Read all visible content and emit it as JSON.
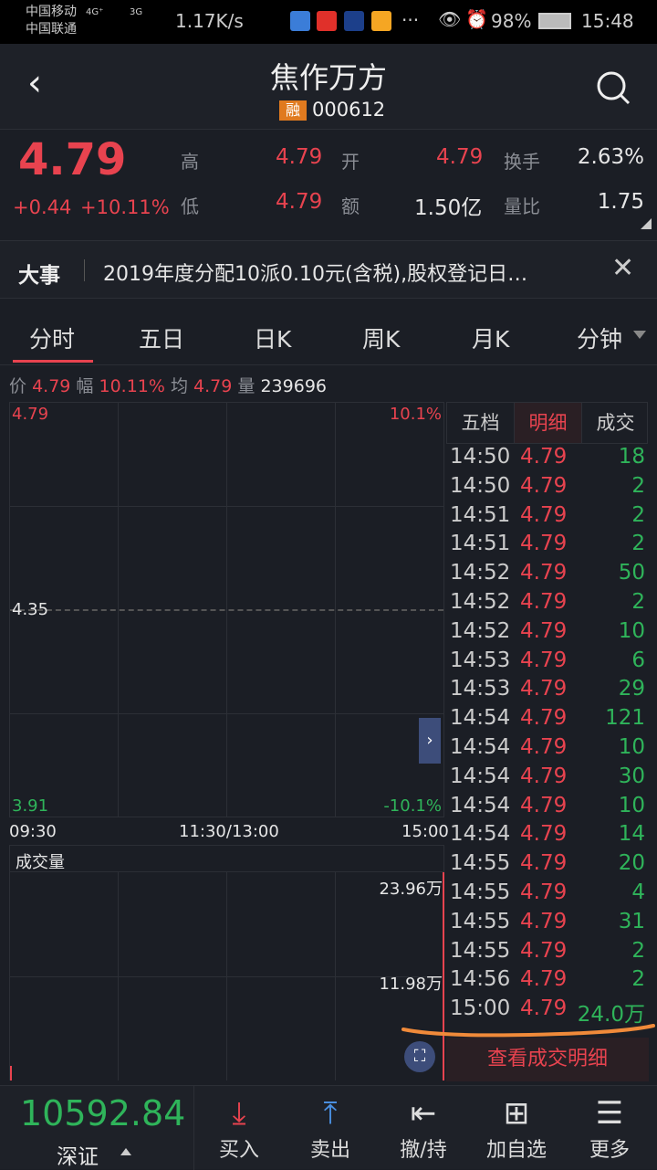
{
  "status": {
    "carrier1": "中国移动",
    "carrier2": "中国联通",
    "net1": "4G⁺",
    "net2": "3G",
    "speed": "1.17K/s",
    "more": "···",
    "battery": "98%",
    "time": "15:48"
  },
  "header": {
    "title": "焦作万方",
    "badge": "融",
    "code": "000612"
  },
  "quote": {
    "price": "4.79",
    "change": "+0.44",
    "pct": "+10.11%",
    "fields": [
      {
        "label": "高",
        "value": "4.79"
      },
      {
        "label": "开",
        "value": "4.79"
      },
      {
        "label": "换手",
        "value": "2.63%"
      },
      {
        "label": "低",
        "value": "4.79"
      },
      {
        "label": "额",
        "value": "1.50亿"
      },
      {
        "label": "量比",
        "value": "1.75"
      }
    ]
  },
  "news": {
    "label": "大事",
    "text": "2019年度分配10派0.10元(含税),股权登记日…"
  },
  "tabs": [
    "分时",
    "五日",
    "日K",
    "周K",
    "月K",
    "分钟"
  ],
  "info": {
    "price_label": "价",
    "price": "4.79",
    "amp_label": "幅",
    "amp": "10.11%",
    "avg_label": "均",
    "avg": "4.79",
    "vol_label": "量",
    "vol": "239696"
  },
  "chart": {
    "top_price": "4.79",
    "top_pct": "10.1%",
    "mid_price": "4.35",
    "bot_price": "3.91",
    "bot_pct": "-10.1%",
    "t0": "09:30",
    "t1": "11:30/13:00",
    "t2": "15:00",
    "vol_title": "成交量",
    "vol_top": "23.96万",
    "vol_mid": "11.98万"
  },
  "detail": {
    "tabs": [
      "五档",
      "明细",
      "成交"
    ],
    "button": "查看成交明细",
    "rows": [
      [
        "14:50",
        "4.79",
        "18"
      ],
      [
        "14:50",
        "4.79",
        "2"
      ],
      [
        "14:51",
        "4.79",
        "2"
      ],
      [
        "14:51",
        "4.79",
        "2"
      ],
      [
        "14:52",
        "4.79",
        "50"
      ],
      [
        "14:52",
        "4.79",
        "2"
      ],
      [
        "14:52",
        "4.79",
        "10"
      ],
      [
        "14:53",
        "4.79",
        "6"
      ],
      [
        "14:53",
        "4.79",
        "29"
      ],
      [
        "14:54",
        "4.79",
        "121"
      ],
      [
        "14:54",
        "4.79",
        "10"
      ],
      [
        "14:54",
        "4.79",
        "30"
      ],
      [
        "14:54",
        "4.79",
        "10"
      ],
      [
        "14:54",
        "4.79",
        "14"
      ],
      [
        "14:55",
        "4.79",
        "20"
      ],
      [
        "14:55",
        "4.79",
        "4"
      ],
      [
        "14:55",
        "4.79",
        "31"
      ],
      [
        "14:55",
        "4.79",
        "2"
      ],
      [
        "14:56",
        "4.79",
        "2"
      ],
      [
        "15:00",
        "4.79",
        "24.0万"
      ]
    ]
  },
  "bottom": {
    "index_value": "10592.84",
    "index_name": "深证",
    "nav": [
      "买入",
      "卖出",
      "撤/持",
      "加自选",
      "更多"
    ]
  }
}
